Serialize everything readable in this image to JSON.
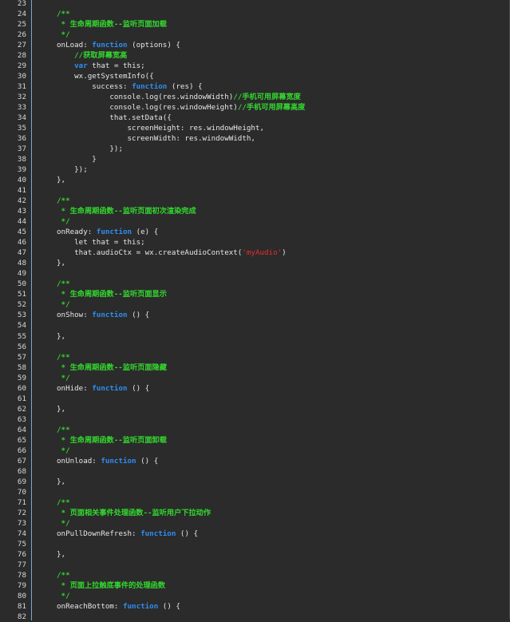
{
  "editor": {
    "first_line_number": 23,
    "colors": {
      "background": "#2b2b2b",
      "gutter_border": "#7aa6d6",
      "comment": "#33d62e",
      "keyword": "#2f8df3",
      "string": "#e82d2d",
      "text": "#e6e6e6"
    },
    "lines": [
      {
        "n": "23",
        "indent": 0,
        "segs": []
      },
      {
        "n": "24",
        "indent": 0,
        "segs": [
          {
            "t": "/**",
            "k": "comment"
          }
        ]
      },
      {
        "n": "25",
        "indent": 1,
        "segs": [
          {
            "t": "* 生命周期函数--监听页面加载",
            "k": "comment"
          }
        ]
      },
      {
        "n": "26",
        "indent": 1,
        "segs": [
          {
            "t": "*/",
            "k": "comment"
          }
        ]
      },
      {
        "n": "27",
        "indent": 0,
        "segs": [
          {
            "t": "onLoad: ",
            "k": "default"
          },
          {
            "t": "function",
            "k": "keyword"
          },
          {
            "t": " (options) {",
            "k": "default"
          }
        ]
      },
      {
        "n": "28",
        "indent": 4,
        "segs": [
          {
            "t": "//获取屏幕宽高",
            "k": "comment"
          }
        ]
      },
      {
        "n": "29",
        "indent": 4,
        "segs": [
          {
            "t": "var",
            "k": "keyword"
          },
          {
            "t": " that = this;",
            "k": "default"
          }
        ]
      },
      {
        "n": "30",
        "indent": 4,
        "segs": [
          {
            "t": "wx.getSystemInfo({",
            "k": "default"
          }
        ]
      },
      {
        "n": "31",
        "indent": 8,
        "segs": [
          {
            "t": "success: ",
            "k": "default"
          },
          {
            "t": "function",
            "k": "keyword"
          },
          {
            "t": " (res) {",
            "k": "default"
          }
        ]
      },
      {
        "n": "32",
        "indent": 12,
        "segs": [
          {
            "t": "console.log(res.windowWidth)",
            "k": "default"
          },
          {
            "t": "//手机可用屏幕宽度",
            "k": "comment"
          }
        ]
      },
      {
        "n": "33",
        "indent": 12,
        "segs": [
          {
            "t": "console.log(res.windowHeight)",
            "k": "default"
          },
          {
            "t": "//手机可用屏幕高度",
            "k": "comment"
          }
        ]
      },
      {
        "n": "34",
        "indent": 12,
        "segs": [
          {
            "t": "that.setData({",
            "k": "default"
          }
        ]
      },
      {
        "n": "35",
        "indent": 16,
        "segs": [
          {
            "t": "screenHeight: res.windowHeight,",
            "k": "default"
          }
        ]
      },
      {
        "n": "36",
        "indent": 16,
        "segs": [
          {
            "t": "screenWidth: res.windowWidth,",
            "k": "default"
          }
        ]
      },
      {
        "n": "37",
        "indent": 12,
        "segs": [
          {
            "t": "});",
            "k": "default"
          }
        ]
      },
      {
        "n": "38",
        "indent": 8,
        "segs": [
          {
            "t": "}",
            "k": "default"
          }
        ]
      },
      {
        "n": "39",
        "indent": 4,
        "segs": [
          {
            "t": "});",
            "k": "default"
          }
        ]
      },
      {
        "n": "40",
        "indent": 0,
        "segs": [
          {
            "t": "},",
            "k": "default"
          }
        ]
      },
      {
        "n": "41",
        "indent": 0,
        "segs": []
      },
      {
        "n": "42",
        "indent": 0,
        "segs": [
          {
            "t": "/**",
            "k": "comment"
          }
        ]
      },
      {
        "n": "43",
        "indent": 1,
        "segs": [
          {
            "t": "* 生命周期函数--监听页面初次渲染完成",
            "k": "comment"
          }
        ]
      },
      {
        "n": "44",
        "indent": 1,
        "segs": [
          {
            "t": "*/",
            "k": "comment"
          }
        ]
      },
      {
        "n": "45",
        "indent": 0,
        "segs": [
          {
            "t": "onReady: ",
            "k": "default"
          },
          {
            "t": "function",
            "k": "keyword"
          },
          {
            "t": " (e) {",
            "k": "default"
          }
        ]
      },
      {
        "n": "46",
        "indent": 4,
        "segs": [
          {
            "t": "let that = this;",
            "k": "default"
          }
        ]
      },
      {
        "n": "47",
        "indent": 4,
        "segs": [
          {
            "t": "that.audioCtx = wx.createAudioContext(",
            "k": "default"
          },
          {
            "t": "'myAudio'",
            "k": "string"
          },
          {
            "t": ")",
            "k": "default"
          }
        ]
      },
      {
        "n": "48",
        "indent": 0,
        "segs": [
          {
            "t": "},",
            "k": "default"
          }
        ]
      },
      {
        "n": "49",
        "indent": 0,
        "segs": []
      },
      {
        "n": "50",
        "indent": 0,
        "segs": [
          {
            "t": "/**",
            "k": "comment"
          }
        ]
      },
      {
        "n": "51",
        "indent": 1,
        "segs": [
          {
            "t": "* 生命周期函数--监听页面显示",
            "k": "comment"
          }
        ]
      },
      {
        "n": "52",
        "indent": 1,
        "segs": [
          {
            "t": "*/",
            "k": "comment"
          }
        ]
      },
      {
        "n": "53",
        "indent": 0,
        "segs": [
          {
            "t": "onShow: ",
            "k": "default"
          },
          {
            "t": "function",
            "k": "keyword"
          },
          {
            "t": " () {",
            "k": "default"
          }
        ]
      },
      {
        "n": "54",
        "indent": 0,
        "segs": []
      },
      {
        "n": "55",
        "indent": 0,
        "segs": [
          {
            "t": "},",
            "k": "default"
          }
        ]
      },
      {
        "n": "56",
        "indent": 0,
        "segs": []
      },
      {
        "n": "57",
        "indent": 0,
        "segs": [
          {
            "t": "/**",
            "k": "comment"
          }
        ]
      },
      {
        "n": "58",
        "indent": 1,
        "segs": [
          {
            "t": "* 生命周期函数--监听页面隐藏",
            "k": "comment"
          }
        ]
      },
      {
        "n": "59",
        "indent": 1,
        "segs": [
          {
            "t": "*/",
            "k": "comment"
          }
        ]
      },
      {
        "n": "60",
        "indent": 0,
        "segs": [
          {
            "t": "onHide: ",
            "k": "default"
          },
          {
            "t": "function",
            "k": "keyword"
          },
          {
            "t": " () {",
            "k": "default"
          }
        ]
      },
      {
        "n": "61",
        "indent": 0,
        "segs": []
      },
      {
        "n": "62",
        "indent": 0,
        "segs": [
          {
            "t": "},",
            "k": "default"
          }
        ]
      },
      {
        "n": "63",
        "indent": 0,
        "segs": []
      },
      {
        "n": "64",
        "indent": 0,
        "segs": [
          {
            "t": "/**",
            "k": "comment"
          }
        ]
      },
      {
        "n": "65",
        "indent": 1,
        "segs": [
          {
            "t": "* 生命周期函数--监听页面卸载",
            "k": "comment"
          }
        ]
      },
      {
        "n": "66",
        "indent": 1,
        "segs": [
          {
            "t": "*/",
            "k": "comment"
          }
        ]
      },
      {
        "n": "67",
        "indent": 0,
        "segs": [
          {
            "t": "onUnload: ",
            "k": "default"
          },
          {
            "t": "function",
            "k": "keyword"
          },
          {
            "t": " () {",
            "k": "default"
          }
        ]
      },
      {
        "n": "68",
        "indent": 0,
        "segs": []
      },
      {
        "n": "69",
        "indent": 0,
        "segs": [
          {
            "t": "},",
            "k": "default"
          }
        ]
      },
      {
        "n": "70",
        "indent": 0,
        "segs": []
      },
      {
        "n": "71",
        "indent": 0,
        "segs": [
          {
            "t": "/**",
            "k": "comment"
          }
        ]
      },
      {
        "n": "72",
        "indent": 1,
        "segs": [
          {
            "t": "* 页面相关事件处理函数--监听用户下拉动作",
            "k": "comment"
          }
        ]
      },
      {
        "n": "73",
        "indent": 1,
        "segs": [
          {
            "t": "*/",
            "k": "comment"
          }
        ]
      },
      {
        "n": "74",
        "indent": 0,
        "segs": [
          {
            "t": "onPullDownRefresh: ",
            "k": "default"
          },
          {
            "t": "function",
            "k": "keyword"
          },
          {
            "t": " () {",
            "k": "default"
          }
        ]
      },
      {
        "n": "75",
        "indent": 0,
        "segs": []
      },
      {
        "n": "76",
        "indent": 0,
        "segs": [
          {
            "t": "},",
            "k": "default"
          }
        ]
      },
      {
        "n": "77",
        "indent": 0,
        "segs": []
      },
      {
        "n": "78",
        "indent": 0,
        "segs": [
          {
            "t": "/**",
            "k": "comment"
          }
        ]
      },
      {
        "n": "79",
        "indent": 1,
        "segs": [
          {
            "t": "* 页面上拉触底事件的处理函数",
            "k": "comment"
          }
        ]
      },
      {
        "n": "80",
        "indent": 1,
        "segs": [
          {
            "t": "*/",
            "k": "comment"
          }
        ]
      },
      {
        "n": "81",
        "indent": 0,
        "segs": [
          {
            "t": "onReachBottom: ",
            "k": "default"
          },
          {
            "t": "function",
            "k": "keyword"
          },
          {
            "t": " () {",
            "k": "default"
          }
        ]
      },
      {
        "n": "82",
        "indent": 0,
        "segs": []
      }
    ]
  }
}
